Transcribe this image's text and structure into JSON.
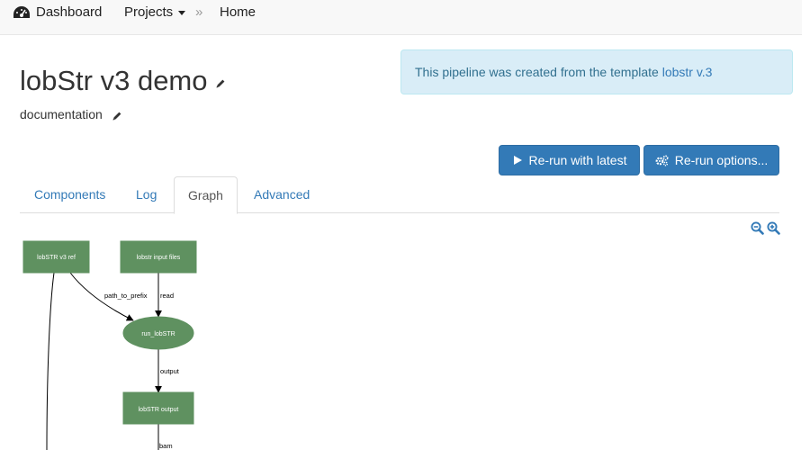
{
  "nav": {
    "dashboard": "Dashboard",
    "projects": "Projects",
    "separator": "»",
    "home": "Home"
  },
  "page": {
    "title": "lobStr v3 demo",
    "documentation": "documentation"
  },
  "alert": {
    "text": "This pipeline was created from the template ",
    "link": "lobstr v.3"
  },
  "buttons": {
    "rerun_latest": "Re-run with latest",
    "rerun_options": "Re-run options..."
  },
  "tabs": [
    "Components",
    "Log",
    "Graph",
    "Advanced"
  ],
  "active_tab": "Graph",
  "graph": {
    "nodes": {
      "ref": "lobSTR v3 ref",
      "input": "lobstr input files",
      "run": "run_lobSTR",
      "output": "lobSTR output"
    },
    "edges": {
      "path_to_prefix": "path_to_prefix",
      "read": "read",
      "output": "output",
      "bam": "bam"
    }
  },
  "colors": {
    "node_fill": "#5f9160",
    "accent": "#337ab7",
    "alert_bg": "#d9edf7"
  }
}
